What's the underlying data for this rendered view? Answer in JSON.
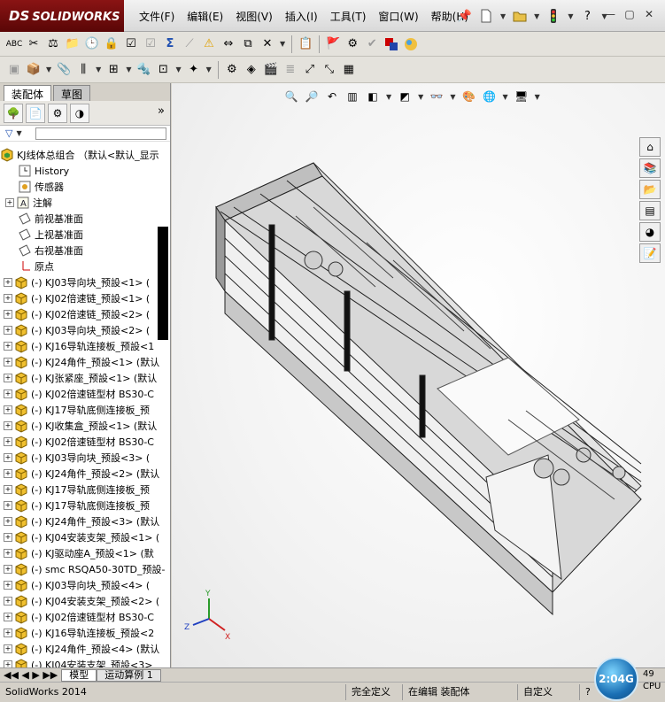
{
  "app": {
    "logo_text": "SOLIDWORKS",
    "logo_ds": "DS"
  },
  "menus": [
    "文件(F)",
    "编辑(E)",
    "视图(V)",
    "插入(I)",
    "工具(T)",
    "窗口(W)",
    "帮助(H)"
  ],
  "panel": {
    "tabs": [
      "装配体",
      "草图"
    ],
    "more": "»"
  },
  "tree": {
    "root": "KJ线体总组合 （默认<默认_显示",
    "fixed_items": [
      {
        "label": "History",
        "icon": "history-icon"
      },
      {
        "label": "传感器",
        "icon": "sensor-icon"
      },
      {
        "label": "注解",
        "icon": "annotation-icon",
        "expandable": true
      },
      {
        "label": "前视基准面",
        "icon": "plane-icon"
      },
      {
        "label": "上视基准面",
        "icon": "plane-icon"
      },
      {
        "label": "右视基准面",
        "icon": "plane-icon"
      },
      {
        "label": "原点",
        "icon": "origin-icon"
      }
    ],
    "components": [
      "(-) KJ03导向块_预設<1> (",
      "(-) KJ02倍速链_预設<1> (",
      "(-) KJ02倍速链_预設<2> (",
      "(-) KJ03导向块_预設<2> (",
      "(-) KJ16导轨连接板_预設<1",
      "(-) KJ24角件_预設<1> (默认",
      "(-) KJ张紧座_预設<1> (默认",
      "(-) KJ02倍速链型材 BS30-C",
      "(-) KJ17导轨底侧连接板_预",
      "(-) KJ收集盒_预設<1> (默认",
      "(-) KJ02倍速链型材 BS30-C",
      "(-) KJ03导向块_预設<3> (",
      "(-) KJ24角件_预設<2> (默认",
      "(-) KJ17导轨底侧连接板_预",
      "(-) KJ17导轨底侧连接板_预",
      "(-) KJ24角件_预設<3> (默认",
      "(-) KJ04安装支架_预設<1> (",
      "(-) KJ驱动座A_预設<1> (默",
      "(-) smc RSQA50-30TD_预設-",
      "(-) KJ03导向块_预設<4> (",
      "(-) KJ04安装支架_预設<2> (",
      "(-) KJ02倍速链型材 BS30-C",
      "(-) KJ16导轨连接板_预設<2",
      "(-) KJ24角件_预設<4> (默认",
      "(-) KJ04安装支架_预設<3>"
    ]
  },
  "triad": {
    "x": "X",
    "y": "Y",
    "z": "Z"
  },
  "bottom_tabs": [
    "模型",
    "运动算例 1"
  ],
  "status": {
    "app_version": "SolidWorks 2014",
    "definition": "完全定义",
    "edit_mode": "在编辑 装配体",
    "custom": "自定义",
    "help": "?"
  },
  "gauge": {
    "memory": "2:04G",
    "percent": "49",
    "cpu_label": "CPU"
  },
  "colors": {
    "logo_bg": "#7a0f0f",
    "viewport_bg": "#f3f3f3",
    "gauge": "#1a6fb4"
  }
}
